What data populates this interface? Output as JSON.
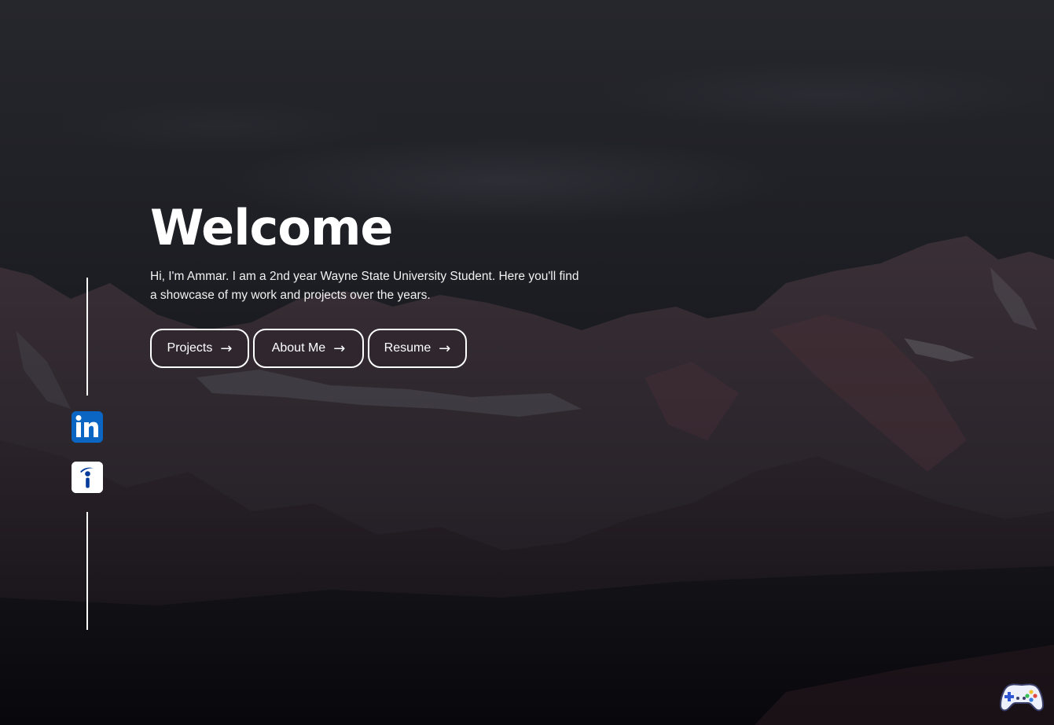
{
  "hero": {
    "title": "Welcome",
    "intro": "Hi, I'm Ammar. I am a 2nd year Wayne State University Student. Here you'll find a showcase of my work and projects over the years."
  },
  "buttons": [
    {
      "label": "Projects",
      "arrow": "→"
    },
    {
      "label": "About Me",
      "arrow": "→"
    },
    {
      "label": "Resume",
      "arrow": "→"
    }
  ],
  "social": {
    "linkedin": {
      "icon": "linkedin-icon",
      "text": "in",
      "color": "#0a66c2"
    },
    "indeed": {
      "icon": "indeed-icon",
      "color": "#003a9b"
    }
  },
  "corner": {
    "icon": "gamepad-icon"
  },
  "colors": {
    "text": "#ffffff",
    "background": "#1a1b20"
  }
}
